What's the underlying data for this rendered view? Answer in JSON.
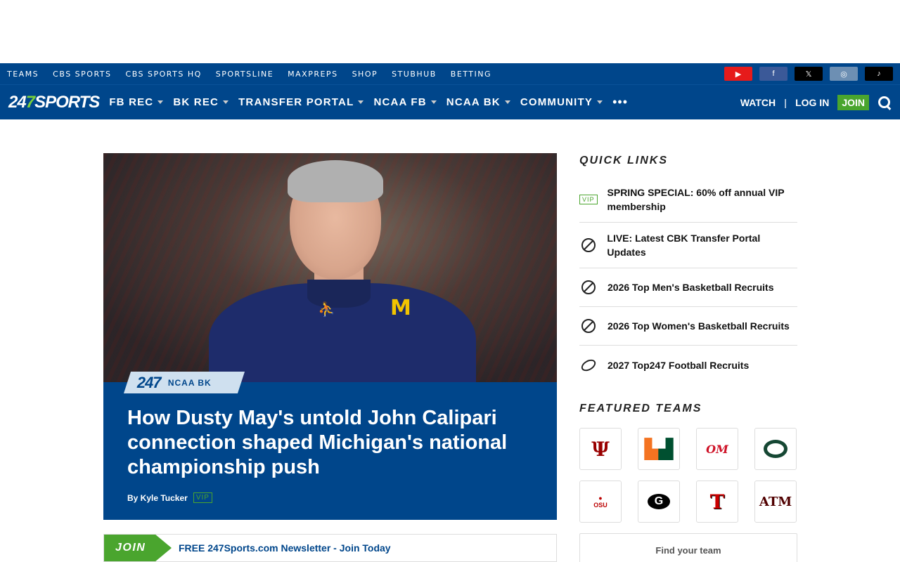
{
  "top_bar": {
    "links": [
      "TEAMS",
      "CBS SPORTS",
      "CBS SPORTS HQ",
      "SPORTSLINE",
      "MAXPREPS",
      "SHOP",
      "STUBHUB",
      "BETTING"
    ],
    "social": [
      "youtube-icon",
      "facebook-icon",
      "x-icon",
      "instagram-icon",
      "tiktok-icon"
    ]
  },
  "nav": {
    "logo_a": "24",
    "logo_b": "7",
    "logo_c": "SPORTS",
    "items": [
      "FB REC",
      "BK REC",
      "TRANSFER PORTAL",
      "NCAA FB",
      "NCAA BK",
      "COMMUNITY"
    ],
    "more": "•••",
    "watch": "WATCH",
    "separator": "|",
    "login": "LOG IN",
    "join": "JOIN"
  },
  "hero": {
    "tag_logo": "247",
    "tag_name": "NCAA BK",
    "headline": "How Dusty May's untold John Calipari connection shaped Michigan's national championship push",
    "byline": "By Kyle Tucker",
    "vip": "VIP"
  },
  "newsletter": {
    "join": "JOIN",
    "text": "FREE 247Sports.com Newsletter - Join Today"
  },
  "quick_links": {
    "title": "QUICK LINKS",
    "items": [
      {
        "icon": "vip-badge",
        "badge": "VIP",
        "label": "SPRING SPECIAL: 60% off annual VIP membership"
      },
      {
        "icon": "transfer-icon",
        "label": "LIVE: Latest CBK Transfer Portal Updates"
      },
      {
        "icon": "basketball-icon",
        "label": "2026 Top Men's Basketball Recruits"
      },
      {
        "icon": "basketball-icon",
        "label": "2026 Top Women's Basketball Recruits"
      },
      {
        "icon": "football-icon",
        "label": "2027 Top247 Football Recruits"
      }
    ]
  },
  "featured_teams": {
    "title": "FEATURED TEAMS",
    "teams": [
      "indiana-logo",
      "miami-logo",
      "ole-miss-logo",
      "oregon-logo",
      "ohio-state-logo",
      "georgia-logo",
      "texas-tech-logo",
      "texas-am-logo"
    ],
    "find_team": "Find your team"
  },
  "colors": {
    "brand_blue": "#00468b",
    "accent_green": "#4aa52e"
  }
}
